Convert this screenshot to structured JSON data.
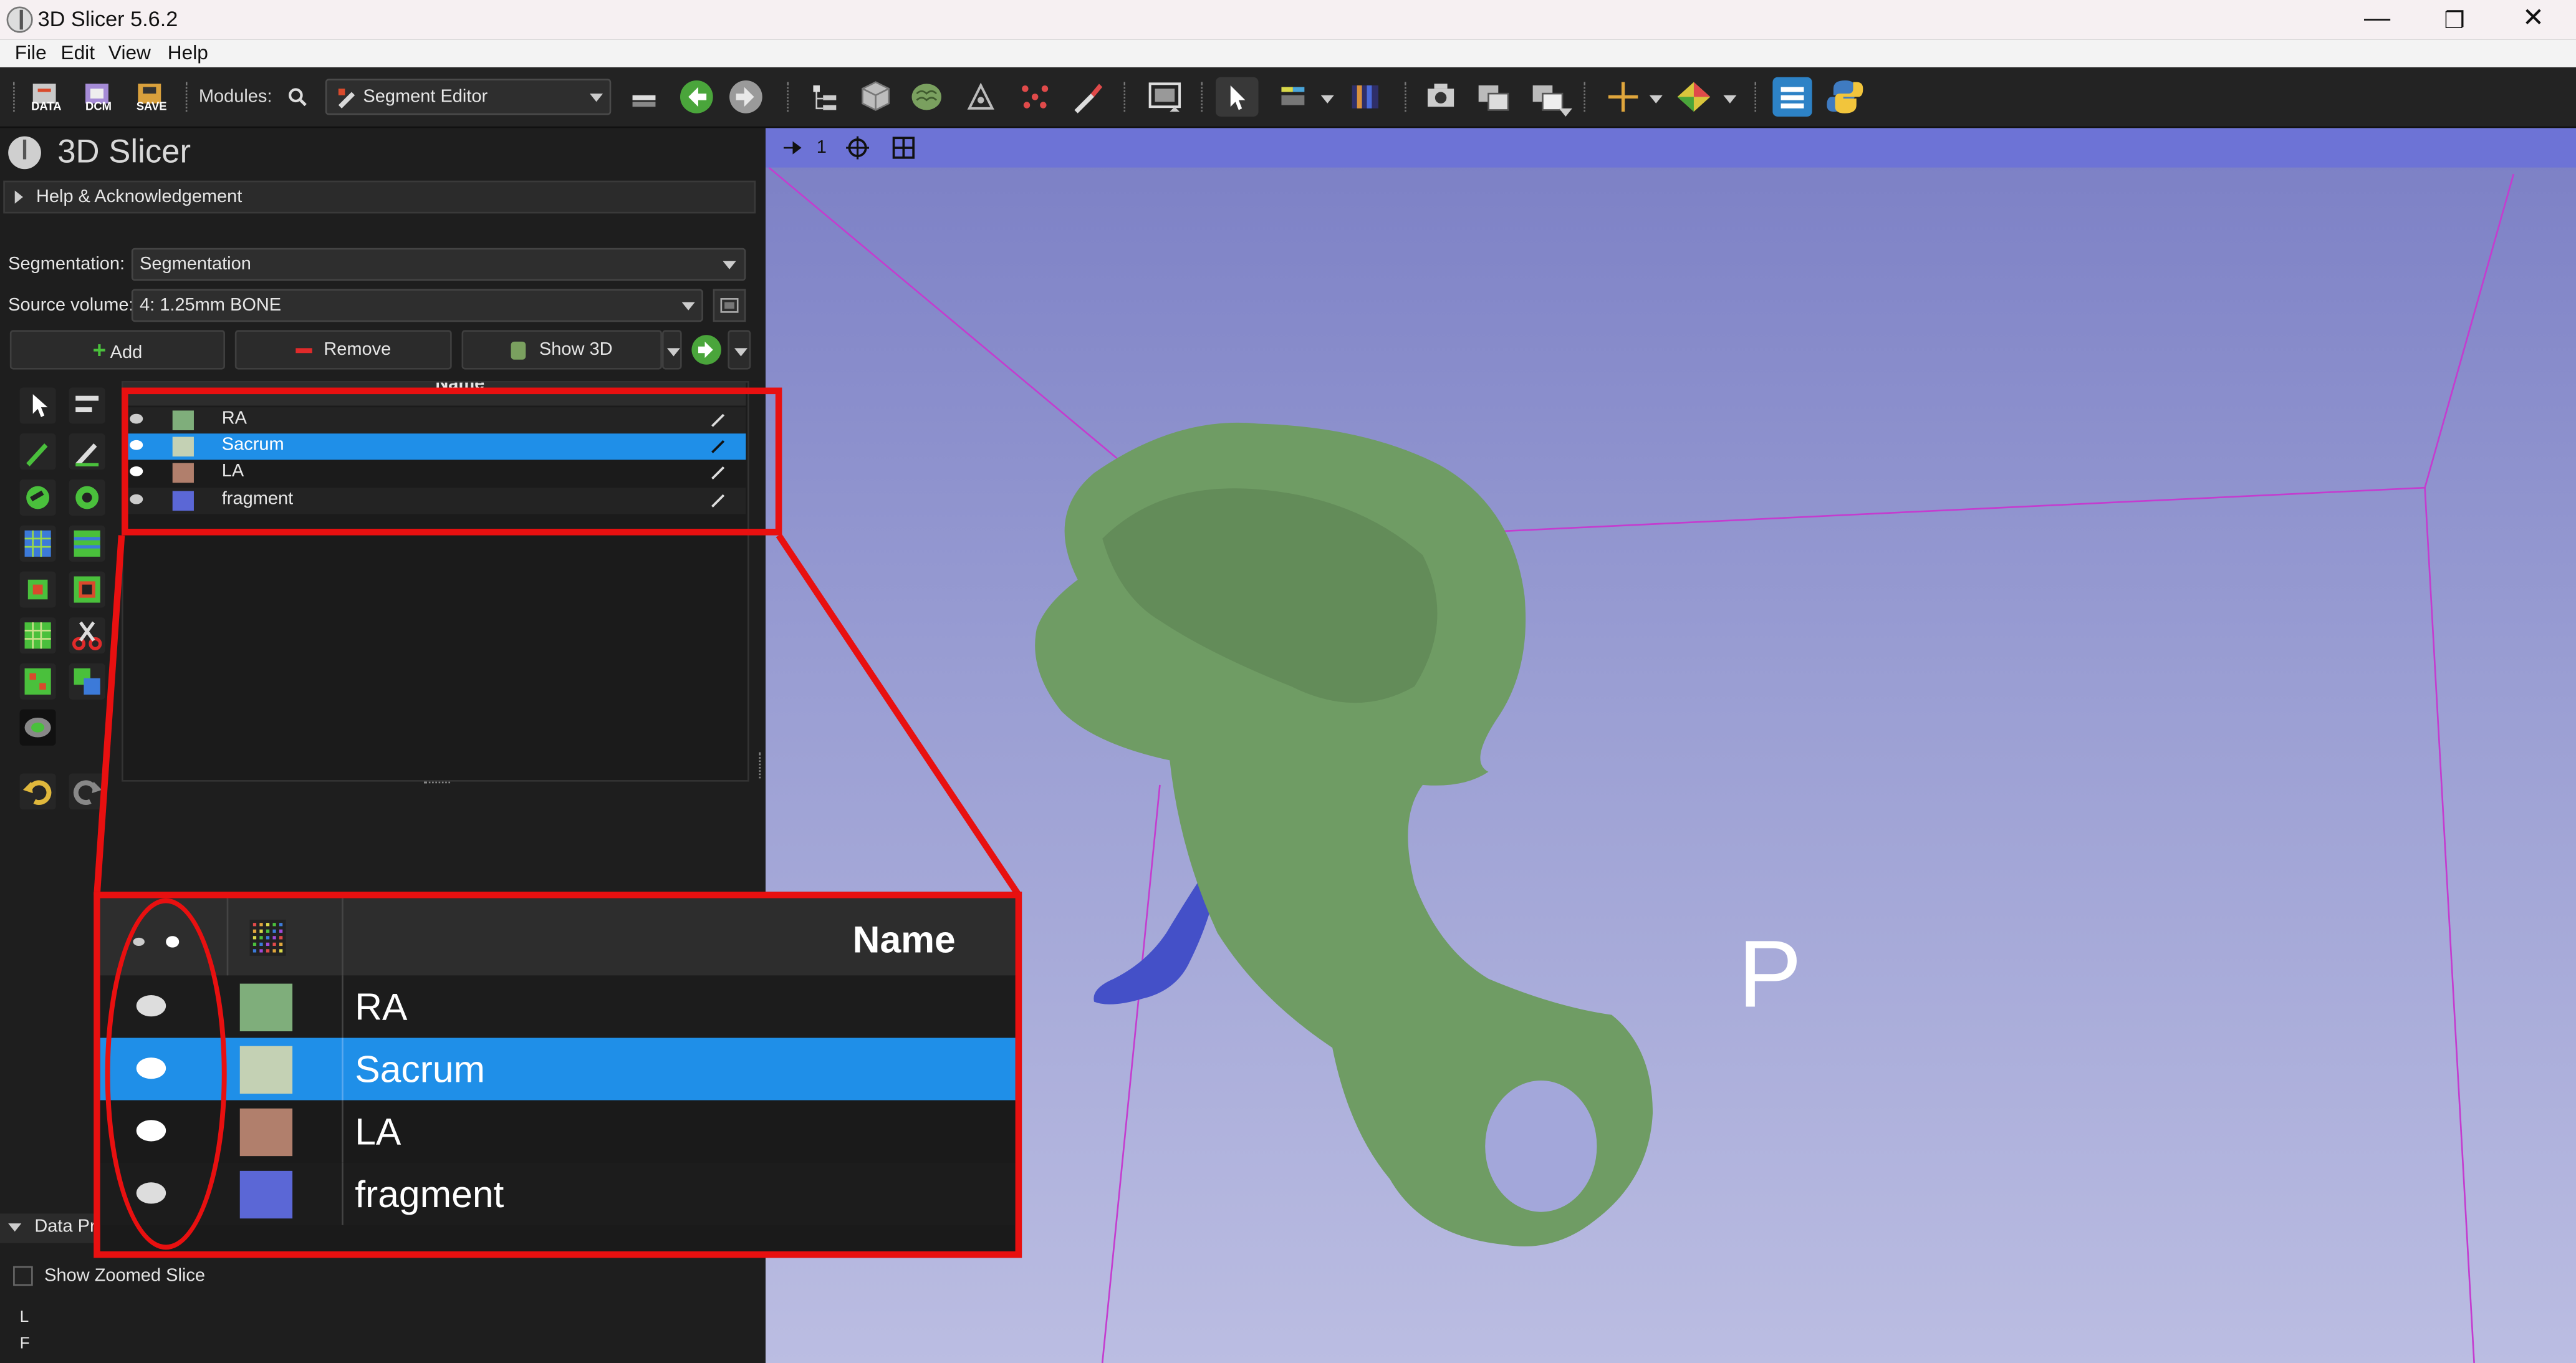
{
  "window": {
    "title": "3D Slicer 5.6.2",
    "controls": {
      "minimize": "—",
      "maximize": "❐",
      "close": "✕"
    }
  },
  "menu": {
    "items": [
      "File",
      "Edit",
      "View",
      "Help"
    ]
  },
  "toolbar": {
    "data_label": "DATA",
    "dcm_label": "DCM",
    "save_label": "SAVE",
    "modules_label": "Modules:",
    "module_selected": "Segment Editor"
  },
  "panel": {
    "logo_text": "3D Slicer",
    "help_section": "Help & Acknowledgement",
    "segmentation_label": "Segmentation:",
    "segmentation_value": "Segmentation",
    "source_volume_label": "Source volume:",
    "source_volume_value": "4: 1.25mm BONE",
    "add_label": "Add",
    "remove_label": "Remove",
    "show3d_label": "Show 3D",
    "table_header_name": "Name",
    "segments": [
      {
        "name": "RA",
        "color": "#7fae7b",
        "visibility": "eye",
        "selected": false
      },
      {
        "name": "Sacrum",
        "color": "#c4d1b4",
        "visibility": "eye-bright",
        "selected": true
      },
      {
        "name": "LA",
        "color": "#b17f6c",
        "visibility": "dot",
        "selected": false
      },
      {
        "name": "fragment",
        "color": "#5b67d6",
        "visibility": "eye",
        "selected": false
      }
    ],
    "data_probe_label": "Data Pr",
    "show_zoomed_slice_label": "Show Zoomed Slice",
    "probe_l": "L",
    "probe_f": "F"
  },
  "view3d": {
    "view_number": "1",
    "orientation_label": "P",
    "bone_color": "#6f9c64",
    "fragment_color": "#4450c8",
    "box_color": "#c43ccf"
  },
  "annotation": {
    "highlight_color": "#e81010",
    "zoom_header_name": "Name",
    "zoom_rows": [
      {
        "name": "RA",
        "color": "#7fae7b"
      },
      {
        "name": "Sacrum",
        "color": "#c4d1b4"
      },
      {
        "name": "LA",
        "color": "#b17f6c"
      },
      {
        "name": "fragment",
        "color": "#5b67d6"
      }
    ]
  }
}
